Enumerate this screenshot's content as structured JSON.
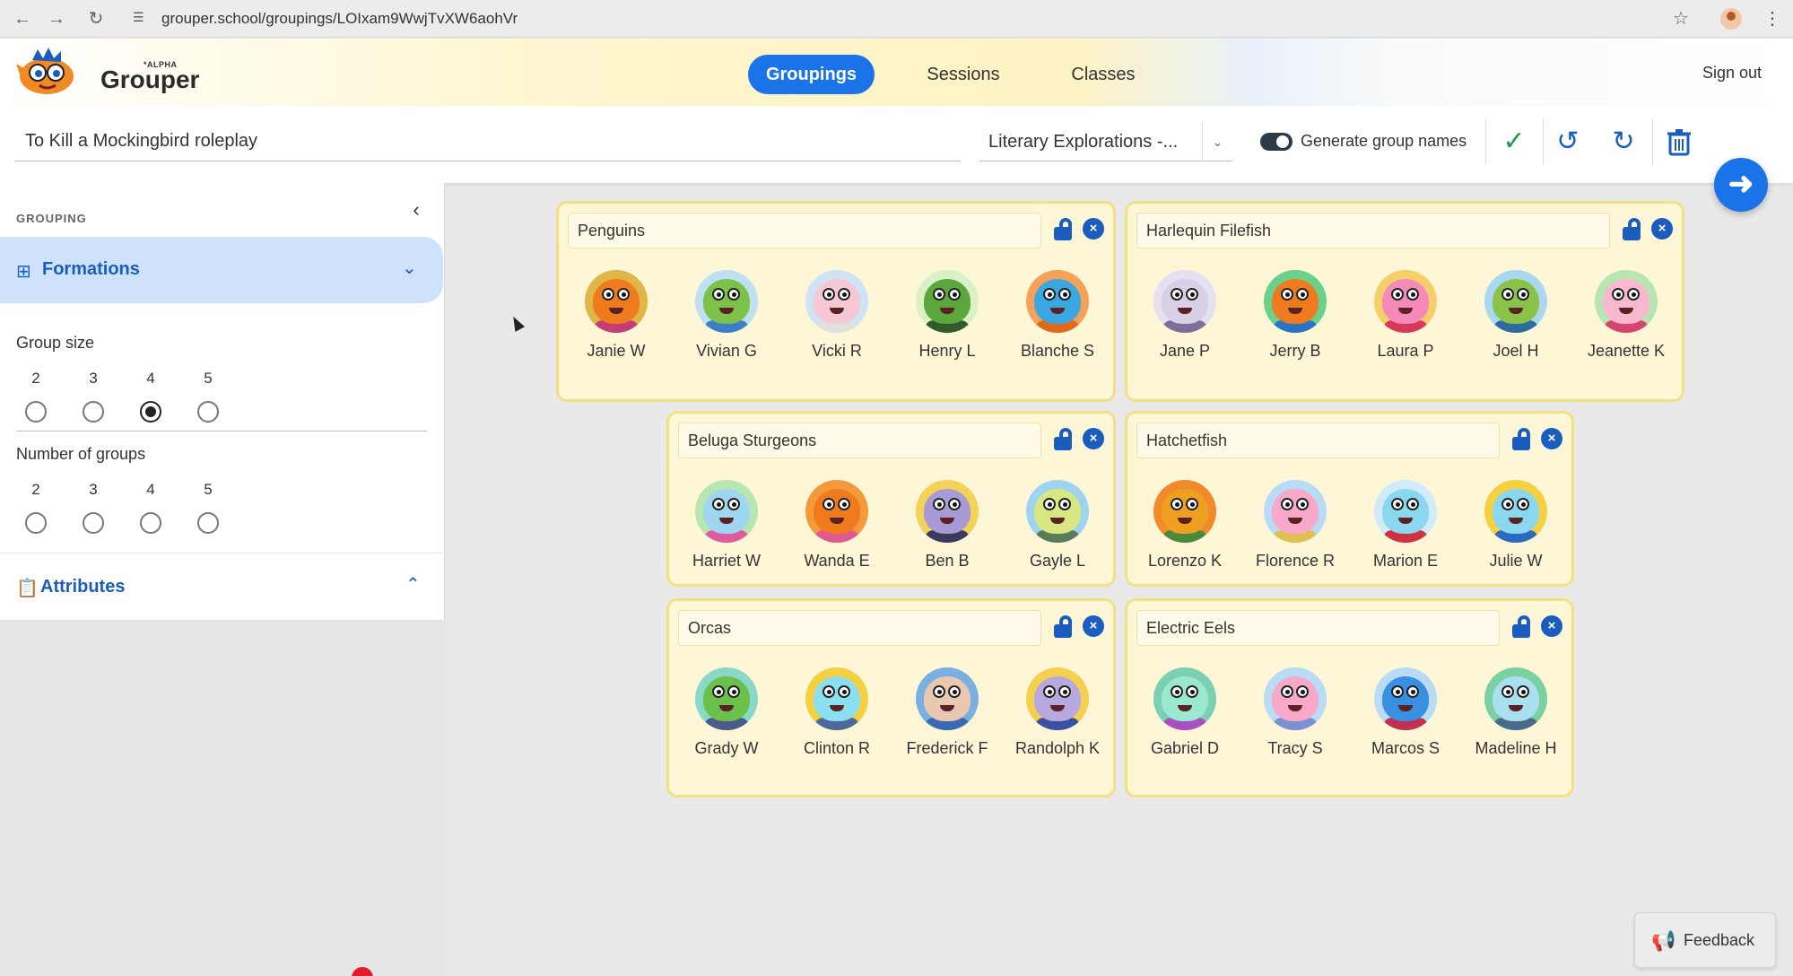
{
  "browser": {
    "url": "grouper.school/groupings/LOIxam9WwjTvXW6aohVr"
  },
  "header": {
    "brand_alpha": "*ALPHA",
    "brand_name": "Grouper",
    "tabs": [
      {
        "label": "Groupings",
        "active": true
      },
      {
        "label": "Sessions",
        "active": false
      },
      {
        "label": "Classes",
        "active": false
      }
    ],
    "sign_out": "Sign out"
  },
  "toolbar": {
    "title_value": "To Kill a Mockingbird roleplay",
    "class_select": "Literary Explorations -...",
    "generate_label": "Generate group names",
    "generate_on": true
  },
  "sidebar": {
    "heading": "GROUPING",
    "formations_label": "Formations",
    "group_size_label": "Group size",
    "group_size_options": [
      "2",
      "3",
      "4",
      "5"
    ],
    "group_size_selected": "4",
    "num_groups_label": "Number of groups",
    "num_groups_options": [
      "2",
      "3",
      "4",
      "5"
    ],
    "attributes_label": "Attributes"
  },
  "groups": [
    {
      "name": "Penguins",
      "members": [
        "Janie W",
        "Vivian G",
        "Vicki R",
        "Henry L",
        "Blanche S"
      ]
    },
    {
      "name": "Harlequin Filefish",
      "members": [
        "Jane P",
        "Jerry B",
        "Laura P",
        "Joel H",
        "Jeanette K"
      ]
    },
    {
      "name": "Beluga Sturgeons",
      "members": [
        "Harriet W",
        "Wanda E",
        "Ben B",
        "Gayle L"
      ]
    },
    {
      "name": "Hatchetfish",
      "members": [
        "Lorenzo K",
        "Florence R",
        "Marion E",
        "Julie W"
      ]
    },
    {
      "name": "Orcas",
      "members": [
        "Grady W",
        "Clinton R",
        "Frederick F",
        "Randolph K"
      ]
    },
    {
      "name": "Electric Eels",
      "members": [
        "Gabriel D",
        "Tracy S",
        "Marcos S",
        "Madeline H"
      ]
    }
  ],
  "feedback_label": "Feedback",
  "colors": {
    "accent": "#1a73e8",
    "accent_dark": "#1a5dbe",
    "group_bg": "#fdf7d8",
    "group_border": "#f3df84",
    "success": "#1e9e4a"
  },
  "icons": [
    "back-icon",
    "forward-icon",
    "reload-icon",
    "star-icon",
    "menu-icon",
    "check-icon",
    "undo-icon",
    "redo-icon",
    "trash-icon",
    "arrow-right-icon",
    "lock-open-icon",
    "close-icon",
    "grid-icon",
    "clipboard-icon",
    "megaphone-icon"
  ]
}
